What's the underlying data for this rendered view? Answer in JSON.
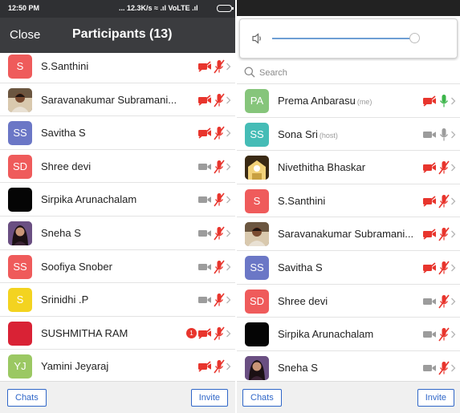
{
  "left": {
    "status": {
      "time": "12:50 PM",
      "network": "... 12.3K/s ≈ .ıl VoLTE .ıl"
    },
    "header": {
      "close_label": "Close",
      "title": "Participants (13)"
    },
    "participants": [
      {
        "initials": "S",
        "name": "S.Santhini",
        "avatar_color": "#ef5b5b",
        "video": "off",
        "audio": "off"
      },
      {
        "initials": "",
        "name": "Saravanakumar Subramani...",
        "avatar_color": "#5f4a3c",
        "photo": "man",
        "video": "off",
        "audio": "off"
      },
      {
        "initials": "SS",
        "name": "Savitha S",
        "avatar_color": "#6b77c6",
        "video": "off",
        "audio": "off"
      },
      {
        "initials": "SD",
        "name": "Shree devi",
        "avatar_color": "#ef5b5b",
        "video": "on",
        "audio": "off"
      },
      {
        "initials": "",
        "name": "Sirpika Arunachalam",
        "avatar_color": "#050505",
        "video": "on",
        "audio": "off"
      },
      {
        "initials": "",
        "name": "Sneha S",
        "avatar_color": "#6a4f82",
        "photo": "woman",
        "video": "on",
        "audio": "off"
      },
      {
        "initials": "SS",
        "name": "Soofiya Snober",
        "avatar_color": "#ef5b5b",
        "video": "on",
        "audio": "off"
      },
      {
        "initials": "S",
        "name": "Srinidhi .P",
        "avatar_color": "#f3d320",
        "video": "on",
        "audio": "off"
      },
      {
        "initials": "",
        "name": "SUSHMITHA RAM",
        "avatar_color": "#d92235",
        "unread": "1",
        "video": "off",
        "audio": "off"
      },
      {
        "initials": "YJ",
        "name": "Yamini Jeyaraj",
        "avatar_color": "#9bc863",
        "video": "off",
        "audio": "off"
      }
    ],
    "footer": {
      "chats_label": "Chats",
      "invite_label": "Invite"
    }
  },
  "right": {
    "search": {
      "placeholder": "Search",
      "value": ""
    },
    "volume_level": 0.94,
    "participants": [
      {
        "initials": "PA",
        "name": "Prema Anbarasu",
        "tag": "(me)",
        "avatar_color": "#86c57b",
        "video": "off",
        "audio": "active"
      },
      {
        "initials": "SS",
        "name": "Sona Sri",
        "tag": "(host)",
        "avatar_color": "#45bcb6",
        "video": "on",
        "audio": "on"
      },
      {
        "initials": "",
        "name": "Nivethitha Bhaskar",
        "avatar_color": "#8a6a2a",
        "photo": "temple",
        "video": "off",
        "audio": "off"
      },
      {
        "initials": "S",
        "name": "S.Santhini",
        "avatar_color": "#ef5b5b",
        "video": "off",
        "audio": "off"
      },
      {
        "initials": "",
        "name": "Saravanakumar Subramani...",
        "avatar_color": "#5f4a3c",
        "photo": "man",
        "video": "off",
        "audio": "off"
      },
      {
        "initials": "SS",
        "name": "Savitha S",
        "avatar_color": "#6b77c6",
        "video": "off",
        "audio": "off"
      },
      {
        "initials": "SD",
        "name": "Shree devi",
        "avatar_color": "#ef5b5b",
        "video": "on",
        "audio": "off"
      },
      {
        "initials": "",
        "name": "Sirpika Arunachalam",
        "avatar_color": "#050505",
        "video": "on",
        "audio": "off"
      },
      {
        "initials": "",
        "name": "Sneha S",
        "avatar_color": "#6a4f82",
        "photo": "woman",
        "video": "on",
        "audio": "off"
      }
    ],
    "footer": {
      "chats_label": "Chats",
      "invite_label": "Invite"
    }
  },
  "colors": {
    "red": "#e8352d",
    "gray_icon": "#9c9c9c",
    "green_mic": "#3cb54a",
    "accent_blue": "#2f66c8"
  }
}
